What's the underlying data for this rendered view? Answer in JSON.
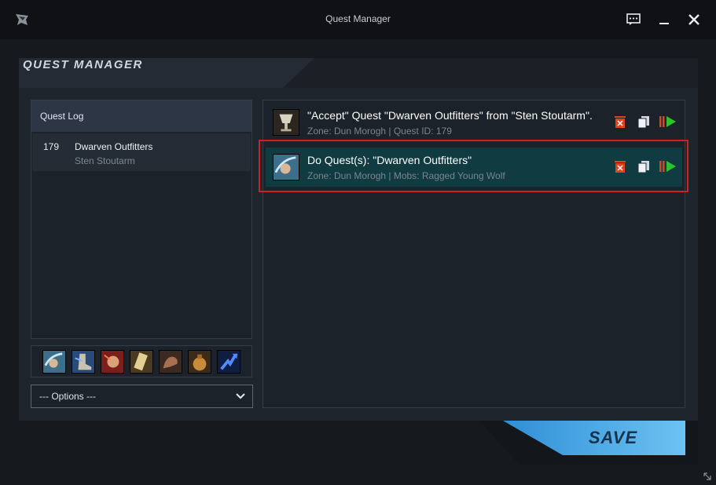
{
  "window": {
    "title": "Quest Manager"
  },
  "heading": "QUEST MANAGER",
  "quest_log": {
    "header": "Quest Log",
    "items": [
      {
        "id": "179",
        "name": "Dwarven Outfitters",
        "giver": "Sten Stoutarm"
      }
    ]
  },
  "skill_icons": [
    "wind-fist-icon",
    "boot-icon",
    "fist-icon",
    "scroll-icon",
    "muscle-arm-icon",
    "coin-bag-icon",
    "blue-arrow-icon"
  ],
  "options": {
    "selected": "--- Options ---"
  },
  "tasks": [
    {
      "title": "\"Accept\" Quest \"Dwarven Outfitters\" from \"Sten Stoutarm\".",
      "subtitle": "Zone: Dun Morogh | Quest ID: 179",
      "icon": "chalice-icon",
      "selected": false
    },
    {
      "title": "Do Quest(s): \"Dwarven Outfitters\"",
      "subtitle": "Zone: Dun Morogh | Mobs: Ragged Young Wolf",
      "icon": "wind-fist-icon",
      "selected": true
    }
  ],
  "save_button": {
    "label": "SAVE"
  },
  "colors": {
    "accent_blue": "#4aa8e6",
    "selection_red": "#d21f1f",
    "active_row": "#0f3b41",
    "delete_red": "#e0421c",
    "play_green": "#2ec32e"
  }
}
